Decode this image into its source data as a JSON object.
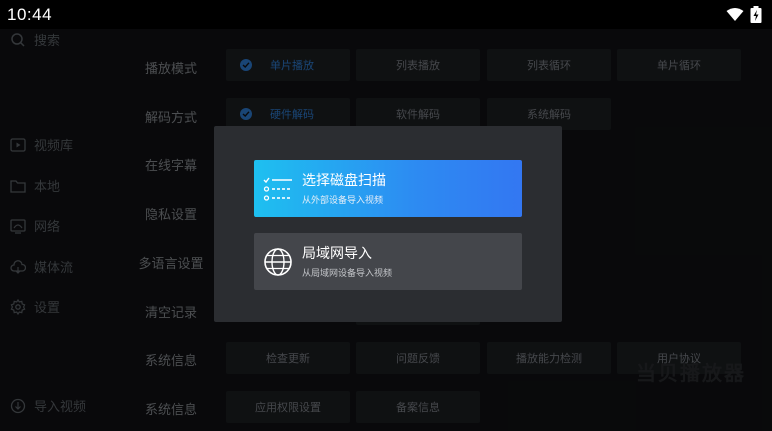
{
  "status": {
    "time": "10:44"
  },
  "sidebar": {
    "search": "搜索",
    "items": [
      {
        "label": "视频库",
        "icon": "video-library-icon"
      },
      {
        "label": "本地",
        "icon": "folder-icon"
      },
      {
        "label": "网络",
        "icon": "network-icon"
      },
      {
        "label": "媒体流",
        "icon": "cloud-icon"
      },
      {
        "label": "设置",
        "icon": "gear-icon"
      }
    ],
    "import": "导入视频"
  },
  "settings": {
    "rows": [
      {
        "label": "播放模式",
        "options": [
          "单片播放",
          "列表播放",
          "列表循环",
          "单片循环"
        ],
        "selected": 0
      },
      {
        "label": "解码方式",
        "options": [
          "硬件解码",
          "软件解码",
          "系统解码"
        ],
        "selected": 0
      },
      {
        "label": "在线字幕",
        "options": []
      },
      {
        "label": "隐私设置",
        "options": []
      },
      {
        "label": "多语言设置",
        "options": []
      },
      {
        "label": "清空记录",
        "options": []
      },
      {
        "label": "系统信息",
        "options": [
          "检查更新",
          "问题反馈",
          "播放能力检测",
          "用户协议"
        ]
      },
      {
        "label": "系统信息",
        "options": [
          "应用权限设置",
          "备案信息"
        ]
      }
    ]
  },
  "watermark": "当贝播放器",
  "dialog": {
    "scan": {
      "title": "选择磁盘扫描",
      "subtitle": "从外部设备导入视频"
    },
    "lan": {
      "title": "局域网导入",
      "subtitle": "从局域网设备导入视频"
    }
  },
  "colors": {
    "accent": "#2f7fd6",
    "gradient_start": "#1ec0f0",
    "gradient_end": "#3377f2"
  }
}
